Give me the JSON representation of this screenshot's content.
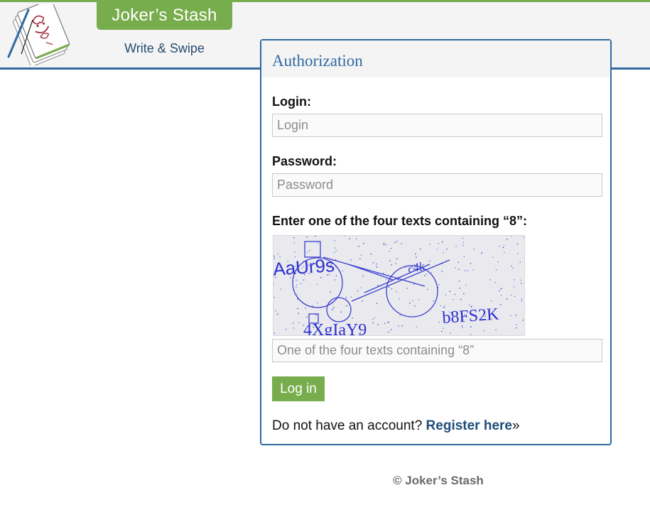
{
  "header": {
    "brand": "Joker’s Stash",
    "tagline": "Write & Swipe",
    "colors": {
      "brand": "#78ad4d",
      "accent": "#2f6aa3"
    }
  },
  "auth": {
    "title": "Authorization",
    "login_label": "Login:",
    "login_placeholder": "Login",
    "password_label": "Password:",
    "password_placeholder": "Password",
    "captcha_label": "Enter one of the four texts containing “8”:",
    "captcha_texts": [
      "AaUr9s",
      "c4k",
      "4XgIaY9",
      "b8FS2K"
    ],
    "captcha_placeholder": "One of the four texts containing “8”",
    "login_button": "Log in",
    "register_prompt": "Do not have an account?",
    "register_link": "Register here",
    "register_suffix": "»"
  },
  "footer": {
    "copyright": "© Joker’s Stash"
  }
}
